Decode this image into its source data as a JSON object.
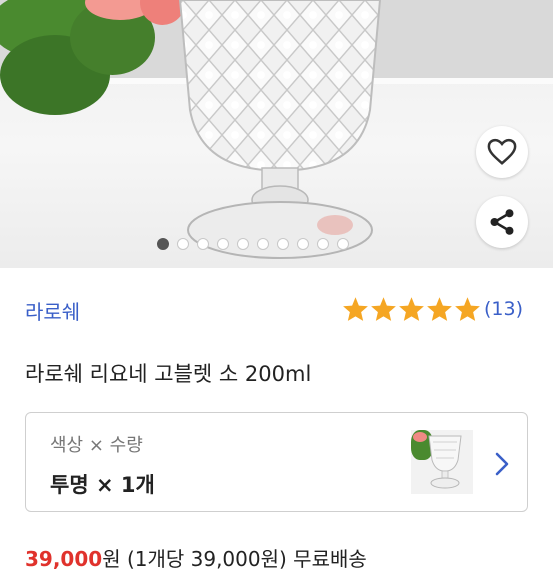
{
  "product_image": {
    "description_icon": "product-photo",
    "carousel_count": 10,
    "carousel_active_index": 0
  },
  "actions": {
    "wishlist_icon": "heart-outline-icon",
    "share_icon": "share-icon"
  },
  "brand": "라로쉐",
  "rating": {
    "stars": 5,
    "max": 5,
    "count_text": "(13)"
  },
  "product_title": "라로쉐 리요네 고블렛 소 200ml",
  "option": {
    "label": "색상 × 수량",
    "value": "투명 × 1개"
  },
  "price_row": {
    "price": "39,000",
    "detail": "원 (1개당 39,000원) 무료배송"
  },
  "colors": {
    "accent_blue": "#3a5fc8",
    "star": "#f5a623",
    "price_red": "#e0322c"
  }
}
